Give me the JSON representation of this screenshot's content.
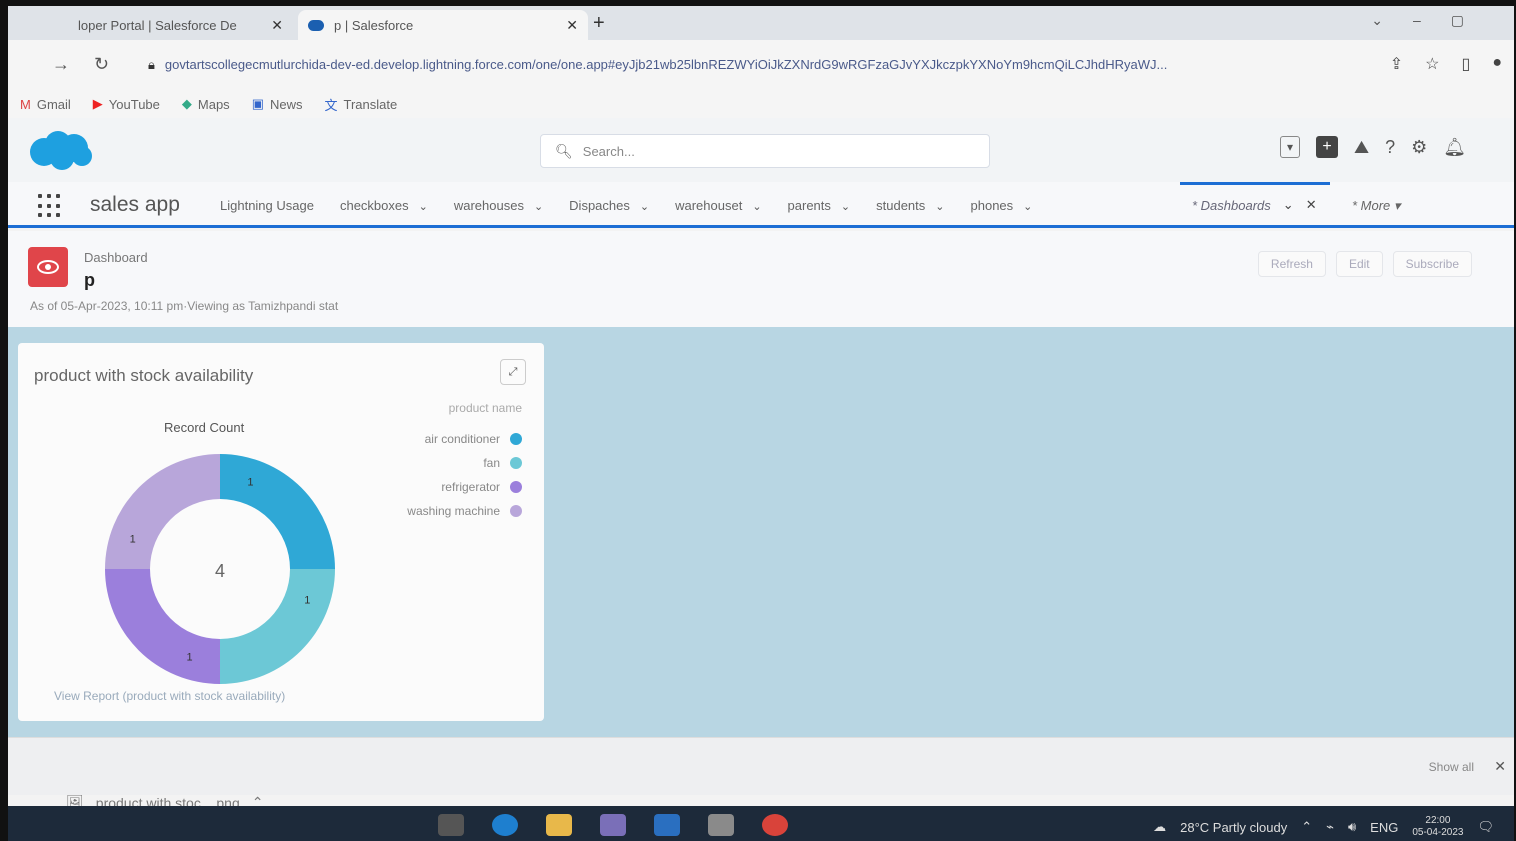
{
  "browser": {
    "tabs": [
      {
        "label": "loper Portal | Salesforce De",
        "close": "✕"
      },
      {
        "label": "p | Salesforce",
        "close": "✕"
      }
    ],
    "new_tab": "+",
    "url": "govtartscollegecmutlurchida-dev-ed.develop.lightning.force.com/one/one.app#eyJjb21wb25lbnREZWYiOiJkZXNrdG9wRGFzaGJvYXJkczpkYXNoYm9hcmQiLCJhdHRyaWJ...",
    "bookmarks": [
      {
        "label": "Gmail",
        "icon": "gmail-icon"
      },
      {
        "label": "YouTube",
        "icon": "youtube-icon"
      },
      {
        "label": "Maps",
        "icon": "maps-icon"
      },
      {
        "label": "News",
        "icon": "news-icon"
      },
      {
        "label": "Translate",
        "icon": "translate-icon"
      }
    ]
  },
  "sf": {
    "search_placeholder": "Search...",
    "app_name": "sales app",
    "nav_items": [
      {
        "label": "Lightning Usage",
        "has_menu": false
      },
      {
        "label": "checkboxes",
        "has_menu": true
      },
      {
        "label": "warehouses",
        "has_menu": true
      },
      {
        "label": "Dispaches",
        "has_menu": true
      },
      {
        "label": "warehouset",
        "has_menu": true
      },
      {
        "label": "parents",
        "has_menu": true
      },
      {
        "label": "students",
        "has_menu": true
      },
      {
        "label": "phones",
        "has_menu": true
      }
    ],
    "active_tab": "* Dashboards",
    "more_label": "* More"
  },
  "dashboard": {
    "type_label": "Dashboard",
    "name": "p",
    "as_of": "As of 05-Apr-2023, 10:11 pm·Viewing as Tamizhpandi stat",
    "actions": [
      "Refresh",
      "Edit",
      "Subscribe"
    ]
  },
  "widget": {
    "title": "product with stock availability",
    "measure_label": "Record Count",
    "total": "4",
    "legend_title": "product name",
    "footer_link": "View Report (product with stock availability)"
  },
  "chart_data": {
    "type": "pie",
    "title": "product with stock availability",
    "subtitle": "Record Count",
    "categories": [
      "air conditioner",
      "fan",
      "refrigerator",
      "washing machine"
    ],
    "values": [
      1,
      1,
      1,
      1
    ],
    "colors": [
      "#2fa8d6",
      "#6cc8d6",
      "#9b7fdc",
      "#b8a6da"
    ],
    "total": 4,
    "legend_title": "product name",
    "legend_position": "top-right"
  },
  "downloads": {
    "file": "product with stoc....png",
    "show_all": "Show all",
    "close": "✕"
  },
  "taskbar": {
    "weather": "28°C  Partly cloudy",
    "lang": "ENG",
    "time": "22:00",
    "date": "05-04-2023"
  }
}
